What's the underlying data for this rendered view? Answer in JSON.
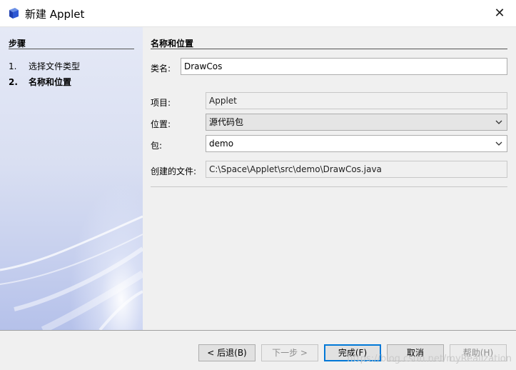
{
  "window": {
    "title": "新建 Applet",
    "close_glyph": "✕"
  },
  "steps": {
    "heading": "步骤",
    "items": [
      {
        "num": "1.",
        "label": "选择文件类型"
      },
      {
        "num": "2.",
        "label": "名称和位置"
      }
    ]
  },
  "form": {
    "section_title": "名称和位置",
    "class_name": {
      "label": "类名:",
      "value": "DrawCos"
    },
    "project": {
      "label": "项目:",
      "value": "Applet"
    },
    "location": {
      "label": "位置:",
      "value": "源代码包"
    },
    "package": {
      "label": "包:",
      "value": "demo"
    },
    "created_file": {
      "label": "创建的文件:",
      "value": "C:\\Space\\Applet\\src\\demo\\DrawCos.java"
    }
  },
  "buttons": {
    "back": "< 后退(B)",
    "next": "下一步 >",
    "finish": "完成(F)",
    "cancel": "取消",
    "help": "帮助(H)"
  },
  "watermark": "https://blog.csdn.net/myRealization",
  "icons": {
    "app": "java-cube-icon",
    "close": "close-icon",
    "dropdown": "chevron-down-icon"
  },
  "colors": {
    "accent": "#0078d7",
    "panel_gradient_top": "#e5e9f6",
    "panel_gradient_bottom": "#b5c1ea"
  }
}
